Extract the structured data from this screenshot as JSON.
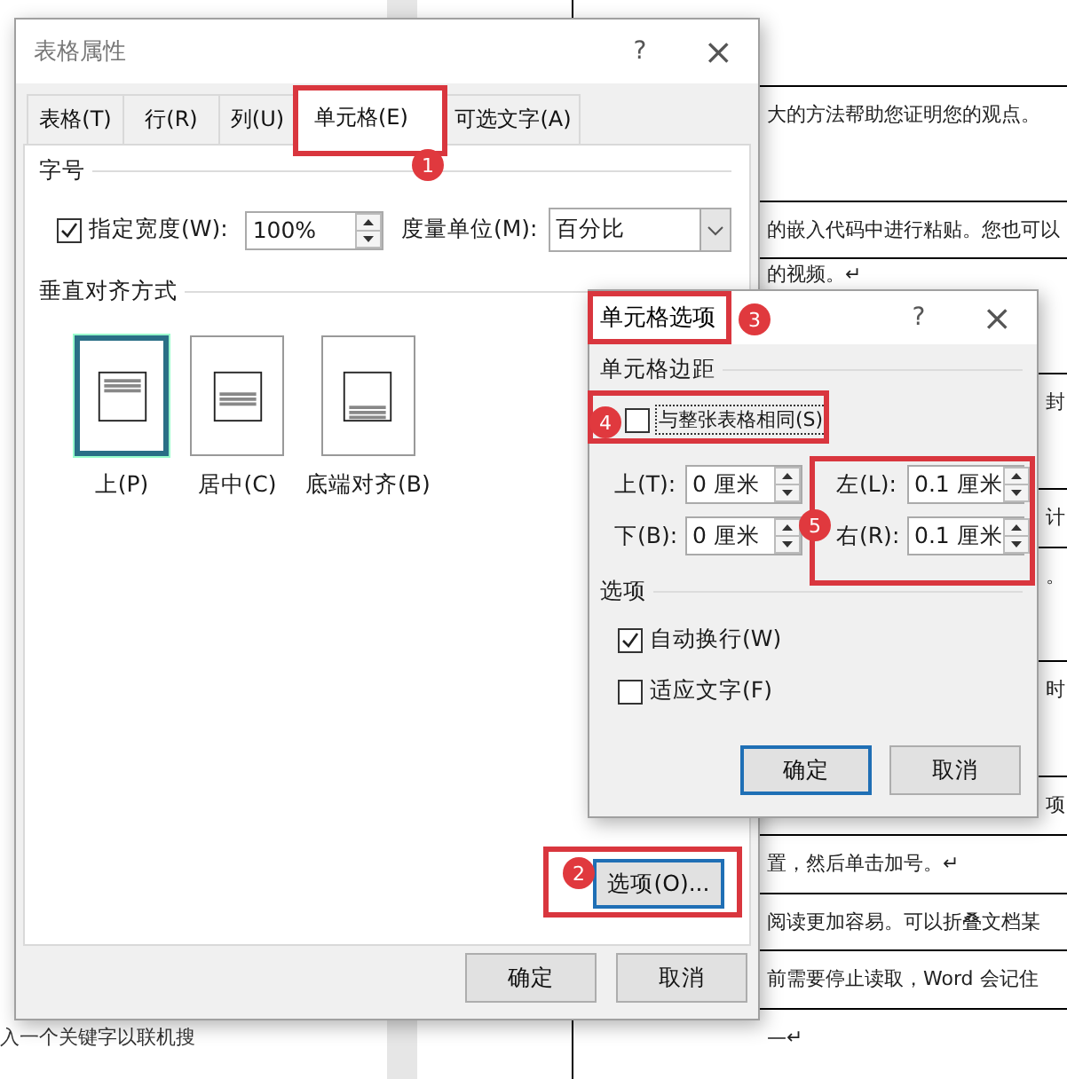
{
  "document": {
    "margin_last_line": "入一个关键字以联机搜",
    "table_rows": [
      {
        "text": "大的方法帮助您证明您的观点。",
        "kind": "wide"
      },
      {
        "text": "的嵌入代码中进行粘贴。您也可以",
        "kind": "wide"
      },
      {
        "text": "的视频。↵",
        "kind": "wide"
      },
      {
        "text": "封",
        "kind": "edge"
      },
      {
        "text": "计",
        "kind": "edge"
      },
      {
        "text": "。",
        "kind": "edge"
      },
      {
        "text": "时",
        "kind": "edge"
      },
      {
        "text": "项",
        "kind": "edge"
      },
      {
        "text": "置，然后单击加号。↵",
        "kind": "wide"
      },
      {
        "text": "阅读更加容易。可以折叠文档某",
        "kind": "wide"
      },
      {
        "text": "前需要停止读取，Word 会记住",
        "kind": "wide"
      },
      {
        "text": "—↵",
        "kind": "wide"
      }
    ]
  },
  "main_dialog": {
    "title": "表格属性",
    "help": "?",
    "close": "×",
    "tabs": [
      {
        "label": "表格(T)",
        "selected": false
      },
      {
        "label": "行(R)",
        "selected": false
      },
      {
        "label": "列(U)",
        "selected": false
      },
      {
        "label": "单元格(E)",
        "selected": true
      },
      {
        "label": "可选文字(A)",
        "selected": false
      }
    ],
    "size_heading": "字号",
    "width_checkbox": {
      "label": "指定宽度(W):",
      "checked": true
    },
    "width_value": "100%",
    "unit_label": "度量单位(M):",
    "unit_value": "百分比",
    "align_heading": "垂直对齐方式",
    "align_options": [
      {
        "label": "上(P)",
        "kind": "top",
        "selected": true
      },
      {
        "label": "居中(C)",
        "kind": "center",
        "selected": false
      },
      {
        "label": "底端对齐(B)",
        "kind": "bottom",
        "selected": false
      }
    ],
    "options_button": "选项(O)...",
    "ok_button": "确定",
    "cancel_button": "取消"
  },
  "cell_options_dialog": {
    "title": "单元格选项",
    "help": "?",
    "close": "×",
    "margin_heading": "单元格边距",
    "same_as_table": {
      "label": "与整张表格相同(S)",
      "checked": false
    },
    "margins": [
      {
        "label": "上(T):",
        "value": "0 厘米"
      },
      {
        "label": "下(B):",
        "value": "0 厘米"
      },
      {
        "label": "左(L):",
        "value": "0.1 厘米"
      },
      {
        "label": "右(R):",
        "value": "0.1 厘米"
      }
    ],
    "options_heading": "选项",
    "options": [
      {
        "label": "自动换行(W)",
        "checked": true
      },
      {
        "label": "适应文字(F)",
        "checked": false
      }
    ],
    "ok_button": "确定",
    "cancel_button": "取消"
  },
  "annotations": [
    {
      "number": "1"
    },
    {
      "number": "2"
    },
    {
      "number": "3"
    },
    {
      "number": "4"
    },
    {
      "number": "5"
    }
  ]
}
